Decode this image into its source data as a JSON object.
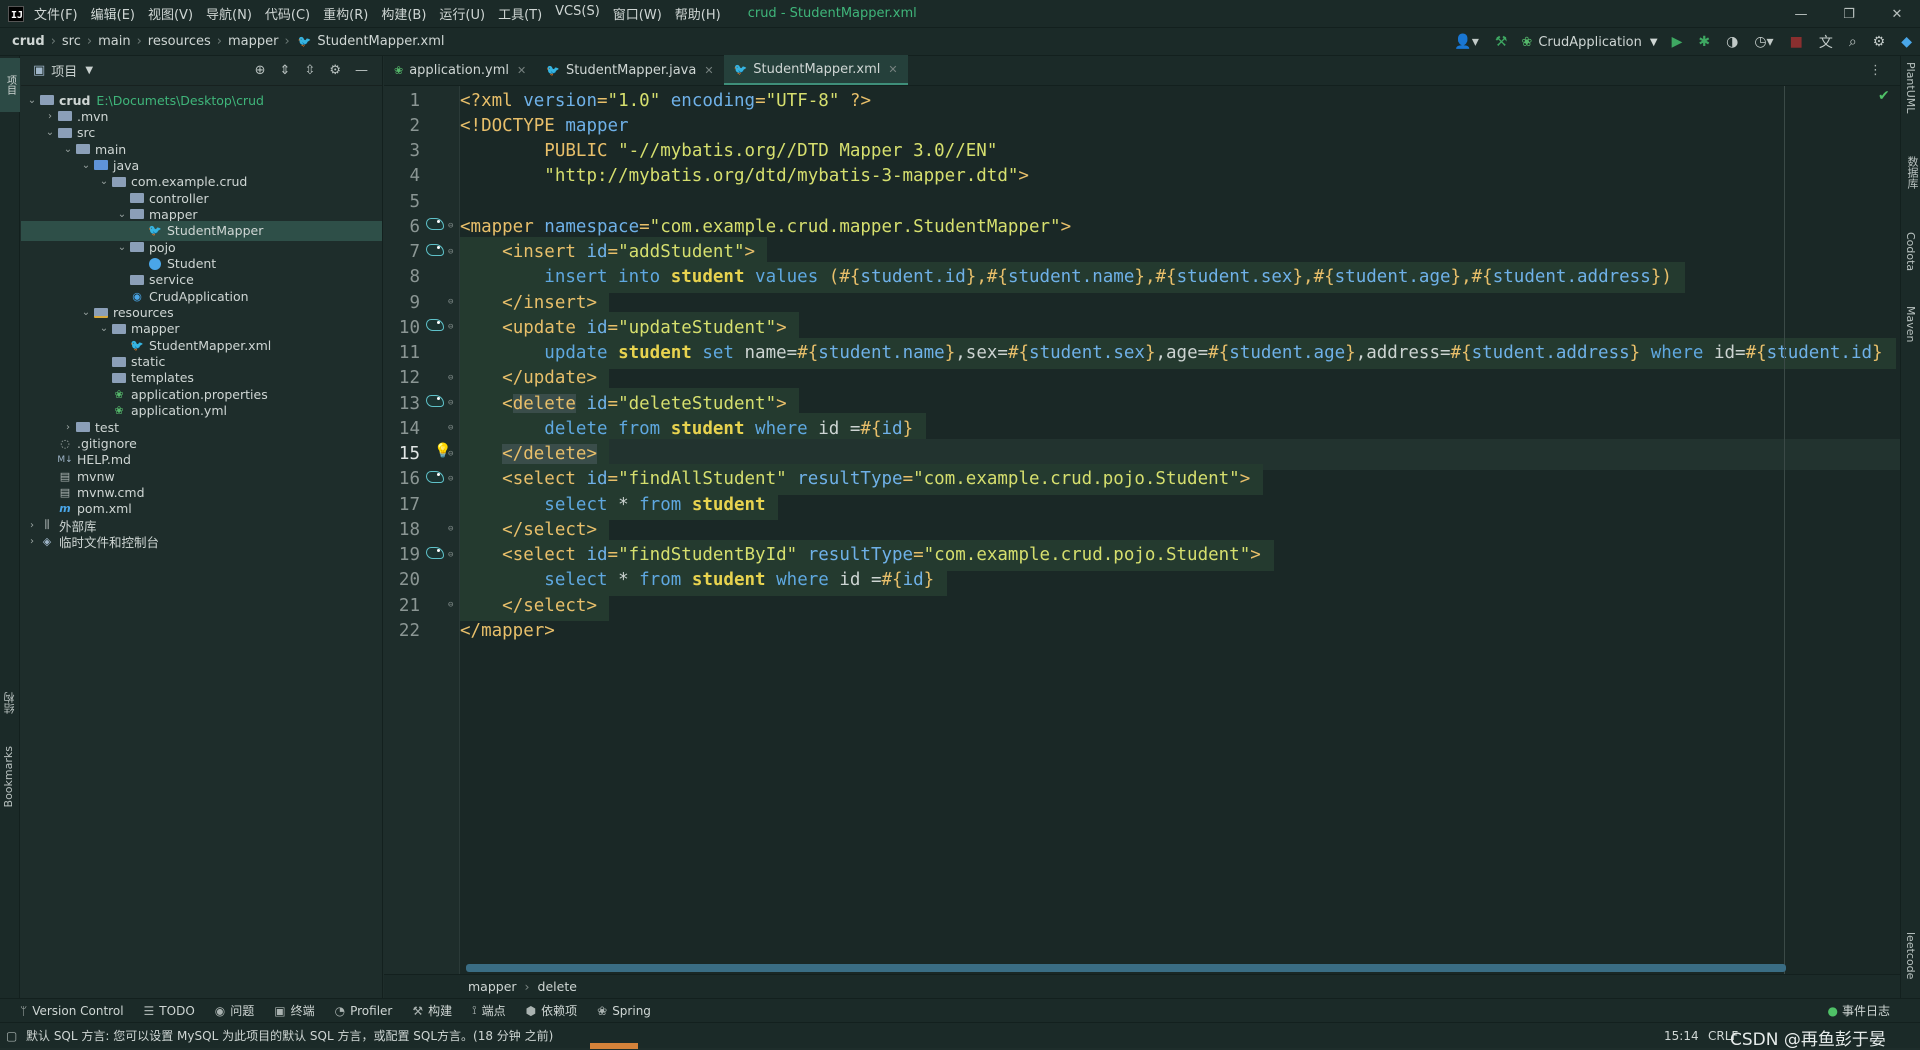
{
  "menubar": {
    "items": [
      "文件(F)",
      "编辑(E)",
      "视图(V)",
      "导航(N)",
      "代码(C)",
      "重构(R)",
      "构建(B)",
      "运行(U)",
      "工具(T)",
      "VCS(S)",
      "窗口(W)",
      "帮助(H)"
    ],
    "window_title": "crud - StudentMapper.xml"
  },
  "navbar": {
    "crumbs": [
      "crud",
      "src",
      "main",
      "resources",
      "mapper",
      "StudentMapper.xml"
    ],
    "run_config": "CrudApplication"
  },
  "leftstrip": {
    "project_tab": "项目",
    "structure": "结构",
    "bookmarks": "Bookmarks"
  },
  "project": {
    "title": "项目",
    "tree": [
      {
        "depth": 0,
        "chev": "v",
        "icon": "folder-icon",
        "label": "crud",
        "path": "E:\\Documets\\Desktop\\crud",
        "bold": true
      },
      {
        "depth": 1,
        "chev": ">",
        "icon": "folder-icon",
        "label": ".mvn"
      },
      {
        "depth": 1,
        "chev": "v",
        "icon": "folder-icon",
        "label": "src"
      },
      {
        "depth": 2,
        "chev": "v",
        "icon": "folder-icon",
        "label": "main"
      },
      {
        "depth": 3,
        "chev": "v",
        "icon": "source-folder-icon",
        "label": "java"
      },
      {
        "depth": 4,
        "chev": "v",
        "icon": "package-icon",
        "label": "com.example.crud"
      },
      {
        "depth": 5,
        "chev": "",
        "icon": "package-icon",
        "label": "controller"
      },
      {
        "depth": 5,
        "chev": "v",
        "icon": "package-icon",
        "label": "mapper"
      },
      {
        "depth": 6,
        "chev": "",
        "icon": "mybatis-mapper-icon",
        "label": "StudentMapper",
        "selected": true
      },
      {
        "depth": 5,
        "chev": "v",
        "icon": "package-icon",
        "label": "pojo"
      },
      {
        "depth": 6,
        "chev": "",
        "icon": "class-icon",
        "label": "Student"
      },
      {
        "depth": 5,
        "chev": "",
        "icon": "package-icon",
        "label": "service"
      },
      {
        "depth": 5,
        "chev": "",
        "icon": "spring-class-icon",
        "label": "CrudApplication"
      },
      {
        "depth": 3,
        "chev": "v",
        "icon": "resources-folder-icon",
        "label": "resources"
      },
      {
        "depth": 4,
        "chev": "v",
        "icon": "folder-icon",
        "label": "mapper"
      },
      {
        "depth": 5,
        "chev": "",
        "icon": "mybatis-xml-icon",
        "label": "StudentMapper.xml"
      },
      {
        "depth": 4,
        "chev": "",
        "icon": "folder-icon",
        "label": "static"
      },
      {
        "depth": 4,
        "chev": "",
        "icon": "folder-icon",
        "label": "templates"
      },
      {
        "depth": 4,
        "chev": "",
        "icon": "spring-properties-icon",
        "label": "application.properties"
      },
      {
        "depth": 4,
        "chev": "",
        "icon": "spring-yaml-icon",
        "label": "application.yml"
      },
      {
        "depth": 2,
        "chev": ">",
        "icon": "folder-icon",
        "label": "test"
      },
      {
        "depth": 1,
        "chev": "",
        "icon": "gitignore-icon",
        "label": ".gitignore"
      },
      {
        "depth": 1,
        "chev": "",
        "icon": "markdown-icon",
        "label": "HELP.md"
      },
      {
        "depth": 1,
        "chev": "",
        "icon": "script-icon",
        "label": "mvnw"
      },
      {
        "depth": 1,
        "chev": "",
        "icon": "script-icon",
        "label": "mvnw.cmd"
      },
      {
        "depth": 1,
        "chev": "",
        "icon": "maven-icon",
        "label": "pom.xml"
      },
      {
        "depth": 0,
        "chev": ">",
        "icon": "libraries-icon",
        "label": "外部库"
      },
      {
        "depth": 0,
        "chev": ">",
        "icon": "scratches-icon",
        "label": "临时文件和控制台"
      }
    ]
  },
  "editor": {
    "tabs": [
      {
        "label": "application.yml",
        "icon": "spring-yaml-icon",
        "active": false
      },
      {
        "label": "StudentMapper.java",
        "icon": "mybatis-mapper-icon",
        "active": false
      },
      {
        "label": "StudentMapper.xml",
        "icon": "mybatis-xml-icon",
        "active": true
      }
    ],
    "current_line": 15,
    "lines": [
      {
        "n": 1,
        "marker": "",
        "tokens": [
          [
            "pun",
            "<?"
          ],
          [
            "tag",
            "xml "
          ],
          [
            "attr",
            "version"
          ],
          [
            "pun",
            "="
          ],
          [
            "str",
            "\"1.0\" "
          ],
          [
            "attr",
            "encoding"
          ],
          [
            "pun",
            "="
          ],
          [
            "str",
            "\"UTF-8\" "
          ],
          [
            "pun",
            "?>"
          ]
        ]
      },
      {
        "n": 2,
        "marker": "",
        "tokens": [
          [
            "pun",
            "<!"
          ],
          [
            "tag",
            "DOCTYPE "
          ],
          [
            "attr",
            "mapper"
          ]
        ]
      },
      {
        "n": 3,
        "marker": "",
        "tokens": [
          [
            "plain",
            "        "
          ],
          [
            "tag",
            "PUBLIC "
          ],
          [
            "str",
            "\"-//mybatis.org//DTD Mapper 3.0//EN\""
          ]
        ]
      },
      {
        "n": 4,
        "marker": "",
        "tokens": [
          [
            "plain",
            "        "
          ],
          [
            "str",
            "\"http://mybatis.org/dtd/mybatis-3-mapper.dtd\""
          ],
          [
            "pun",
            ">"
          ]
        ]
      },
      {
        "n": 5,
        "marker": "",
        "tokens": []
      },
      {
        "n": 6,
        "marker": "bird",
        "tokens": [
          [
            "tag",
            "<mapper "
          ],
          [
            "attr",
            "namespace"
          ],
          [
            "pun",
            "="
          ],
          [
            "str",
            "\"com.example.crud.mapper.StudentMapper\""
          ],
          [
            "tag",
            ">"
          ]
        ]
      },
      {
        "n": 7,
        "marker": "bird",
        "hl": true,
        "tokens": [
          [
            "plain",
            "    "
          ],
          [
            "tag",
            "<insert "
          ],
          [
            "attr",
            "id"
          ],
          [
            "pun",
            "="
          ],
          [
            "str",
            "\"addStudent\""
          ],
          [
            "tag",
            ">"
          ]
        ]
      },
      {
        "n": 8,
        "marker": "",
        "hl": true,
        "tokens": [
          [
            "plain",
            "        "
          ],
          [
            "kw",
            "insert into "
          ],
          [
            "tbl",
            "student "
          ],
          [
            "kw",
            "values "
          ],
          [
            "pun",
            "("
          ],
          [
            "ph",
            "#{"
          ],
          [
            "dt",
            "student.id"
          ],
          [
            "ph",
            "}"
          ],
          [
            "pun",
            ","
          ],
          [
            "ph",
            "#{"
          ],
          [
            "dt",
            "student.name"
          ],
          [
            "ph",
            "}"
          ],
          [
            "pun",
            ","
          ],
          [
            "ph",
            "#{"
          ],
          [
            "dt",
            "student.sex"
          ],
          [
            "ph",
            "}"
          ],
          [
            "pun",
            ","
          ],
          [
            "ph",
            "#{"
          ],
          [
            "dt",
            "student.age"
          ],
          [
            "ph",
            "}"
          ],
          [
            "pun",
            ","
          ],
          [
            "ph",
            "#{"
          ],
          [
            "dt",
            "student.address"
          ],
          [
            "ph",
            "}"
          ],
          [
            "pun",
            ")"
          ]
        ]
      },
      {
        "n": 9,
        "marker": "",
        "hl": true,
        "tokens": [
          [
            "plain",
            "    "
          ],
          [
            "tag",
            "</insert>"
          ]
        ]
      },
      {
        "n": 10,
        "marker": "bird",
        "hl": true,
        "tokens": [
          [
            "plain",
            "    "
          ],
          [
            "tag",
            "<update "
          ],
          [
            "attr",
            "id"
          ],
          [
            "pun",
            "="
          ],
          [
            "str",
            "\"updateStudent\""
          ],
          [
            "tag",
            ">"
          ]
        ]
      },
      {
        "n": 11,
        "marker": "",
        "hl": true,
        "tokens": [
          [
            "plain",
            "        "
          ],
          [
            "kw",
            "update "
          ],
          [
            "tbl",
            "student "
          ],
          [
            "kw",
            "set "
          ],
          [
            "plain",
            "name="
          ],
          [
            "ph",
            "#{"
          ],
          [
            "dt",
            "student.name"
          ],
          [
            "ph",
            "}"
          ],
          [
            "plain",
            ",sex="
          ],
          [
            "ph",
            "#{"
          ],
          [
            "dt",
            "student.sex"
          ],
          [
            "ph",
            "}"
          ],
          [
            "plain",
            ",age="
          ],
          [
            "ph",
            "#{"
          ],
          [
            "dt",
            "student.age"
          ],
          [
            "ph",
            "}"
          ],
          [
            "plain",
            ",address="
          ],
          [
            "ph",
            "#{"
          ],
          [
            "dt",
            "student.address"
          ],
          [
            "ph",
            "}"
          ],
          [
            "kw",
            " where "
          ],
          [
            "plain",
            "id="
          ],
          [
            "ph",
            "#{"
          ],
          [
            "dt",
            "student.id"
          ],
          [
            "ph",
            "}"
          ]
        ]
      },
      {
        "n": 12,
        "marker": "",
        "hl": true,
        "tokens": [
          [
            "plain",
            "    "
          ],
          [
            "tag",
            "</update>"
          ]
        ]
      },
      {
        "n": 13,
        "marker": "bird",
        "hl": true,
        "tokens": [
          [
            "plain",
            "    "
          ],
          [
            "tag",
            "<"
          ],
          [
            "taghl",
            "delete"
          ],
          [
            "plain",
            " "
          ],
          [
            "attr",
            "id"
          ],
          [
            "pun",
            "="
          ],
          [
            "str",
            "\"deleteStudent\""
          ],
          [
            "tag",
            ">"
          ]
        ]
      },
      {
        "n": 14,
        "marker": "",
        "hl": true,
        "tokens": [
          [
            "plain",
            "        "
          ],
          [
            "kw",
            "delete from "
          ],
          [
            "tbl",
            "student "
          ],
          [
            "kw",
            "where "
          ],
          [
            "plain",
            "id ="
          ],
          [
            "ph",
            "#{"
          ],
          [
            "dt",
            "id"
          ],
          [
            "ph",
            "}"
          ]
        ]
      },
      {
        "n": 15,
        "marker": "bulb",
        "hl": true,
        "tokens": [
          [
            "plain",
            "    "
          ],
          [
            "taghl",
            "</delete>"
          ]
        ]
      },
      {
        "n": 16,
        "marker": "bird",
        "hl": true,
        "tokens": [
          [
            "plain",
            "    "
          ],
          [
            "tag",
            "<select "
          ],
          [
            "attr",
            "id"
          ],
          [
            "pun",
            "="
          ],
          [
            "str",
            "\"findAllStudent\" "
          ],
          [
            "attr",
            "resultType"
          ],
          [
            "pun",
            "="
          ],
          [
            "str",
            "\"com.example.crud.pojo.Student\""
          ],
          [
            "tag",
            ">"
          ]
        ]
      },
      {
        "n": 17,
        "marker": "",
        "hl": true,
        "tokens": [
          [
            "plain",
            "        "
          ],
          [
            "kw",
            "select "
          ],
          [
            "plain",
            "* "
          ],
          [
            "kw",
            "from "
          ],
          [
            "tbl",
            "student"
          ]
        ]
      },
      {
        "n": 18,
        "marker": "",
        "hl": true,
        "tokens": [
          [
            "plain",
            "    "
          ],
          [
            "tag",
            "</select>"
          ]
        ]
      },
      {
        "n": 19,
        "marker": "bird",
        "hl": true,
        "tokens": [
          [
            "plain",
            "    "
          ],
          [
            "tag",
            "<select "
          ],
          [
            "attr",
            "id"
          ],
          [
            "pun",
            "="
          ],
          [
            "str",
            "\"findStudentById\" "
          ],
          [
            "attr",
            "resultType"
          ],
          [
            "pun",
            "="
          ],
          [
            "str",
            "\"com.example.crud.pojo.Student\""
          ],
          [
            "tag",
            ">"
          ]
        ]
      },
      {
        "n": 20,
        "marker": "",
        "hl": true,
        "tokens": [
          [
            "plain",
            "        "
          ],
          [
            "kw",
            "select "
          ],
          [
            "plain",
            "* "
          ],
          [
            "kw",
            "from "
          ],
          [
            "tbl",
            "student "
          ],
          [
            "kw",
            "where "
          ],
          [
            "plain",
            "id ="
          ],
          [
            "ph",
            "#{"
          ],
          [
            "dt",
            "id"
          ],
          [
            "ph",
            "}"
          ]
        ]
      },
      {
        "n": 21,
        "marker": "",
        "hl": true,
        "tokens": [
          [
            "plain",
            "    "
          ],
          [
            "tag",
            "</select>"
          ]
        ]
      },
      {
        "n": 22,
        "marker": "",
        "tokens": [
          [
            "tag",
            "</mapper>"
          ]
        ]
      }
    ],
    "breadcrumb": [
      "mapper",
      "delete"
    ]
  },
  "rightstrip": [
    "PlantUML",
    "数据库",
    "Codota",
    "Maven",
    "leetcode"
  ],
  "tool_windows": [
    {
      "label": "Version Control",
      "icon": "vcs-icon"
    },
    {
      "label": "TODO",
      "icon": "todo-icon"
    },
    {
      "label": "问题",
      "icon": "problems-icon"
    },
    {
      "label": "终端",
      "icon": "terminal-icon"
    },
    {
      "label": "Profiler",
      "icon": "profiler-icon"
    },
    {
      "label": "构建",
      "icon": "build-icon"
    },
    {
      "label": "端点",
      "icon": "endpoints-icon"
    },
    {
      "label": "依赖项",
      "icon": "dependencies-icon"
    },
    {
      "label": "Spring",
      "icon": "spring-icon"
    }
  ],
  "event_log": "事件日志",
  "status": {
    "message": "默认 SQL 方言: 您可以设置 MySQL 为此项目的默认 SQL 方言，或配置 SQL方言。(18 分钟 之前)",
    "position": "15:14",
    "encoding": "CRLF",
    "watermark": "CSDN @再鱼彭于晏"
  },
  "colors": {
    "background": "#1e2d2b",
    "selection": "#2e4f48",
    "xml_tag": "#e8bf6a",
    "attr": "#6fb1e8",
    "string": "#d6df6e",
    "sql_keyword": "#5fa8e0",
    "table_name": "#e8d34f",
    "highlight_block": "#243a2f"
  }
}
